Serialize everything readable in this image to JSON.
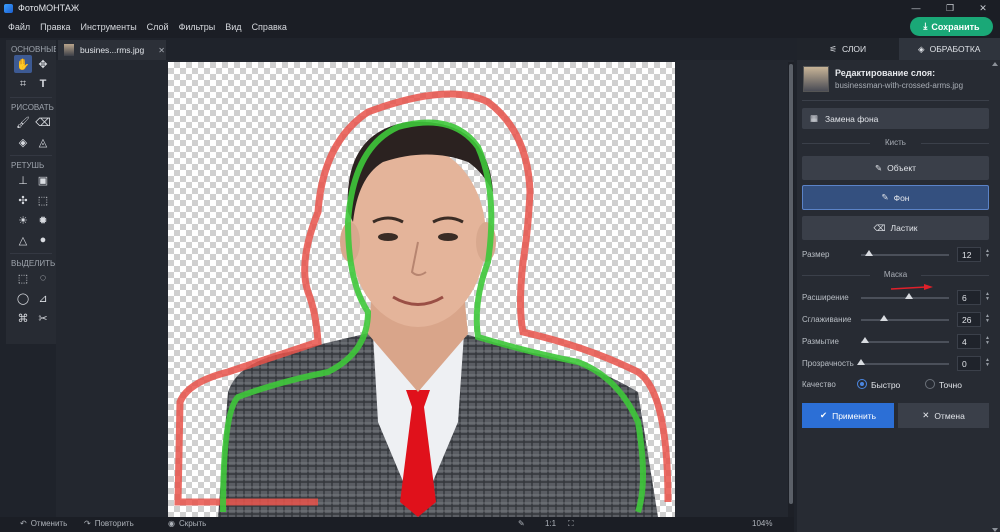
{
  "app": {
    "title": "ФотоМОНТАЖ"
  },
  "menu": [
    "Файл",
    "Правка",
    "Инструменты",
    "Слой",
    "Фильтры",
    "Вид",
    "Справка"
  ],
  "save_label": "Сохранить",
  "toolbar": {
    "sections": [
      "ОСНОВНЫЕ",
      "РИСОВАТЬ",
      "РЕТУШЬ",
      "ВЫДЕЛИТЬ"
    ]
  },
  "document": {
    "tab_label": "busines...rms.jpg"
  },
  "bottom": {
    "items": [
      "Отменить",
      "Повторить",
      "Скрыть"
    ],
    "ratio": "1:1",
    "zoom": "104%"
  },
  "panel": {
    "tabs": [
      "СЛОИ",
      "ОБРАБОТКА"
    ],
    "layer_title": "Редактирование слоя:",
    "layer_file": "businessman-with-crossed-arms.jpg",
    "bg_replace": "Замена фона",
    "brush_section": "Кисть",
    "brush_object": "Объект",
    "brush_background": "Фон",
    "brush_eraser": "Ластик",
    "size_label": "Размер",
    "size_value": "12",
    "mask_section": "Маска",
    "sliders": [
      {
        "label": "Расширение",
        "value": "6",
        "fraction": 0.55
      },
      {
        "label": "Сглаживание",
        "value": "26",
        "fraction": 0.26
      },
      {
        "label": "Размытие",
        "value": "4",
        "fraction": 0.05
      },
      {
        "label": "Прозрачность",
        "value": "0",
        "fraction": 0.0
      }
    ],
    "quality_label": "Качество",
    "quality_fast": "Быстро",
    "quality_precise": "Точно",
    "apply_label": "Применить",
    "cancel_label": "Отмена"
  },
  "colors": {
    "accent": "#1aa877",
    "selection": "#34507f",
    "apply": "#2c6fd6",
    "mask_keep": "#3ec83a",
    "mask_remove": "#e8524a"
  }
}
